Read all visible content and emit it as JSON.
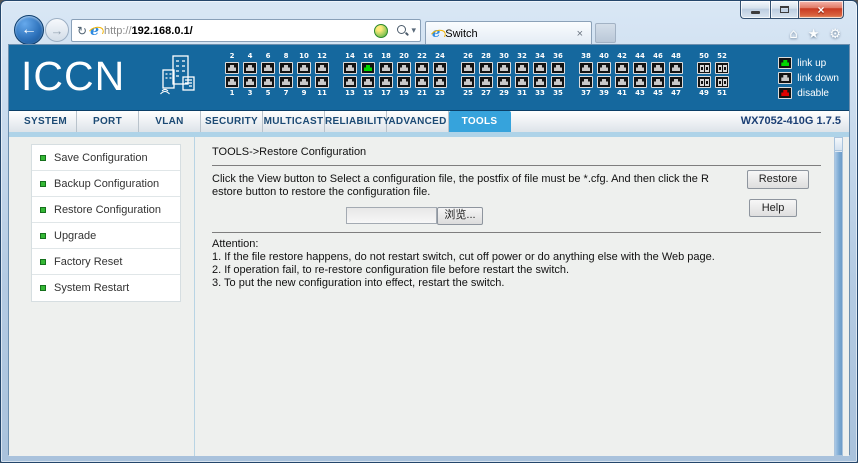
{
  "browser": {
    "url_scheme": "http://",
    "url_host": "192.168.0.1/",
    "tab_title": "Switch",
    "icons": {
      "back": "←",
      "forward": "→",
      "refresh": "↻",
      "search_dropdown": "▾",
      "home": "⌂",
      "favorites": "★",
      "settings": "⚙",
      "tab_close": "×",
      "window_close": "×"
    }
  },
  "header": {
    "logo": "ICCN",
    "ports": {
      "groups": [
        {
          "top": [
            2,
            4,
            6,
            8,
            10,
            12
          ],
          "bottom": [
            1,
            3,
            5,
            7,
            9,
            11
          ],
          "type": "rj45"
        },
        {
          "top": [
            14,
            16,
            18,
            20,
            22,
            24
          ],
          "bottom": [
            13,
            15,
            17,
            19,
            21,
            23
          ],
          "type": "rj45"
        },
        {
          "top": [
            26,
            28,
            30,
            32,
            34,
            36
          ],
          "bottom": [
            25,
            27,
            29,
            31,
            33,
            35
          ],
          "type": "rj45"
        },
        {
          "top": [
            38,
            40,
            42,
            44,
            46,
            48
          ],
          "bottom": [
            37,
            39,
            41,
            43,
            45,
            47
          ],
          "type": "rj45"
        },
        {
          "top": [
            50,
            52
          ],
          "bottom": [
            49,
            51
          ],
          "type": "sfp"
        }
      ],
      "link_up_ports": [
        16
      ],
      "state_colors": {
        "up": "#00d800",
        "down": "#c9c9c9",
        "disable": "#e00000"
      }
    },
    "legend": [
      {
        "state": "up",
        "label": "link up"
      },
      {
        "state": "down",
        "label": "link down"
      },
      {
        "state": "disable",
        "label": "disable"
      }
    ]
  },
  "nav": {
    "tabs": [
      "SYSTEM",
      "PORT",
      "VLAN",
      "SECURITY",
      "MULTICAST",
      "RELIABILITY",
      "ADVANCED",
      "TOOLS"
    ],
    "active_tab": "TOOLS",
    "device_info": "WX7052-410G 1.7.5"
  },
  "sidebar": {
    "items": [
      "Save Configuration",
      "Backup Configuration",
      "Restore Configuration",
      "Upgrade",
      "Factory Reset",
      "System Restart"
    ]
  },
  "content": {
    "breadcrumb": "TOOLS->Restore Configuration",
    "description_line1": "Click the View button to Select a configuration file, the postfix of file must be *.cfg. And then click the R",
    "description_line2": "estore button to restore the configuration file.",
    "file_input_value": "",
    "browse_button": "浏览...",
    "restore_button": "Restore",
    "help_button": "Help",
    "attention_title": "Attention:",
    "attention_items": [
      "1. If the file restore happens, do not restart switch, cut off power or do anything else with the Web page.",
      "2. If operation fail, to re-restore configuration file before restart the switch.",
      "3. To put the new configuration into effect, restart the switch."
    ]
  }
}
